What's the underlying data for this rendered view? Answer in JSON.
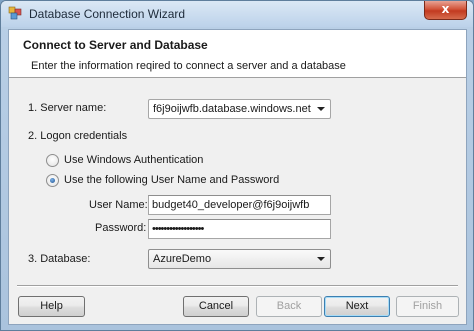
{
  "window": {
    "title": "Database Connection Wizard",
    "close_glyph": "x"
  },
  "header": {
    "title": "Connect to Server and Database",
    "subtitle": "Enter the information reqired to connect a server and a database"
  },
  "server": {
    "label": "1. Server name:",
    "value": "f6j9oijwfb.database.windows.net"
  },
  "logon": {
    "label": "2. Logon credentials",
    "options": [
      {
        "label": "Use Windows Authentication",
        "selected": false
      },
      {
        "label": "Use the following User Name and Password",
        "selected": true
      }
    ],
    "username_label": "User Name:",
    "username_value": "budget40_developer@f6j9oijwfb",
    "password_label": "Password:",
    "password_value": "••••••••••••••••••"
  },
  "database": {
    "label": "3. Database:",
    "value": "AzureDemo"
  },
  "buttons": {
    "help": "Help",
    "cancel": "Cancel",
    "back": "Back",
    "next": "Next",
    "finish": "Finish"
  },
  "icons": {
    "app": "database-wizard-icon",
    "close": "close-icon",
    "dropdown": "chevron-down-icon"
  }
}
